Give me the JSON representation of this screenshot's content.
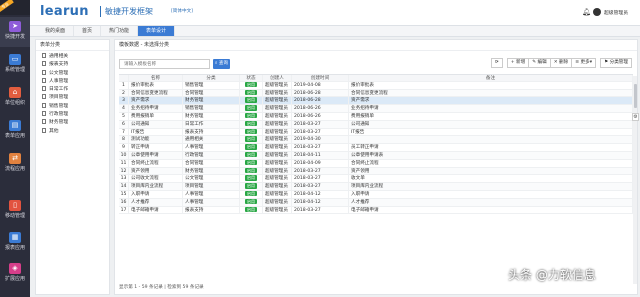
{
  "sidebar": {
    "badge": "专业",
    "items": [
      {
        "label": "快捷开发",
        "icon": "send-icon",
        "color": "#8e5cd9"
      },
      {
        "label": "系统管理",
        "icon": "monitor-icon",
        "color": "#3b7bd4"
      },
      {
        "label": "单位组织",
        "icon": "org-icon",
        "color": "#e25d3f"
      },
      {
        "label": "表单应用",
        "icon": "form-icon",
        "color": "#3b7bd4"
      },
      {
        "label": "流程应用",
        "icon": "flow-icon",
        "color": "#e2823f"
      },
      {
        "label": "移动管理",
        "icon": "mobile-icon",
        "color": "#e2533f"
      },
      {
        "label": "报表应用",
        "icon": "report-icon",
        "color": "#3b7bd4"
      },
      {
        "label": "扩展应用",
        "icon": "extend-icon",
        "color": "#d63e8a"
      }
    ]
  },
  "header": {
    "logo": "learun",
    "subtitle": "敏捷开发框架",
    "lang": "[简体中文]",
    "user": "超级管理员"
  },
  "tabs": [
    "我的桌面",
    "首页",
    "热门功能",
    "表单设计"
  ],
  "tree": {
    "title": "表单分类",
    "items": [
      "通用相关",
      "报表支持",
      "公文管理",
      "人事管理",
      "日常工作",
      "项目管理",
      "销售管理",
      "行政管理",
      "财务管理",
      "其他"
    ]
  },
  "main": {
    "title": "模板数据 - 未选择分类",
    "search_placeholder": "请输入模板名称",
    "search_button": "查询",
    "toolbar": {
      "refresh": "⟳",
      "add": "+ 新增",
      "edit": "✎ 编辑",
      "delete": "✕ 删除",
      "more": "≡ 更多▾",
      "category": "⚑ 分类管理"
    },
    "columns": [
      "",
      "名称",
      "分类",
      "状态",
      "创建人",
      "创建时间",
      "备注"
    ],
    "rows": [
      [
        "1",
        "报价审批表",
        "销售管理",
        "启用",
        "超级管理员",
        "2019-04-08",
        "报价审批表"
      ],
      [
        "2",
        "合同信息变更流程",
        "合同管理",
        "启用",
        "超级管理员",
        "2018-06-28",
        "合同信息变更流程"
      ],
      [
        "3",
        "资产需求",
        "财务管理",
        "启用",
        "超级管理员",
        "2018-06-28",
        "资产需求"
      ],
      [
        "4",
        "业务招待申请",
        "销售管理",
        "启用",
        "超级管理员",
        "2018-06-26",
        "业务招待申请"
      ],
      [
        "5",
        "费用报销单",
        "财务管理",
        "启用",
        "超级管理员",
        "2018-06-26",
        "费用报销单"
      ],
      [
        "6",
        "公司通知",
        "日常工作",
        "启用",
        "超级管理员",
        "2018-03-27",
        "公司通知"
      ],
      [
        "7",
        "IT报告",
        "报表支持",
        "启用",
        "超级管理员",
        "2018-03-27",
        "IT报告"
      ],
      [
        "8",
        "测试功能",
        "通用相关",
        "启用",
        "超级管理员",
        "2019-04-30",
        ""
      ],
      [
        "9",
        "转正申请",
        "人事管理",
        "启用",
        "超级管理员",
        "2018-03-27",
        "员工转正申请"
      ],
      [
        "10",
        "公章使用申请",
        "行政管理",
        "启用",
        "超级管理员",
        "2018-04-11",
        "公章使用申请表"
      ],
      [
        "11",
        "合同终止流程",
        "合同管理",
        "启用",
        "超级管理员",
        "2018-04-09",
        "合同终止流程"
      ],
      [
        "12",
        "资产领用",
        "财务管理",
        "启用",
        "超级管理员",
        "2018-03-27",
        "资产领用"
      ],
      [
        "13",
        "公司收文流程",
        "公文管理",
        "启用",
        "超级管理员",
        "2018-03-27",
        "收文单"
      ],
      [
        "14",
        "项目库内业流程",
        "项目管理",
        "启用",
        "超级管理员",
        "2018-03-27",
        "项目库内业流程"
      ],
      [
        "15",
        "入职申请",
        "人事管理",
        "启用",
        "超级管理员",
        "2018-04-12",
        "入职申请"
      ],
      [
        "16",
        "人才推荐",
        "人事管理",
        "启用",
        "超级管理员",
        "2018-04-12",
        "人才推荐"
      ],
      [
        "17",
        "电子邮箱申请",
        "报表支持",
        "启用",
        "超级管理员",
        "2018-03-27",
        "电子邮箱申请"
      ]
    ],
    "footer": "显示第 1 - 59 条记录 | 检索到 59 条记录"
  },
  "watermark": "头条 @力软信息"
}
